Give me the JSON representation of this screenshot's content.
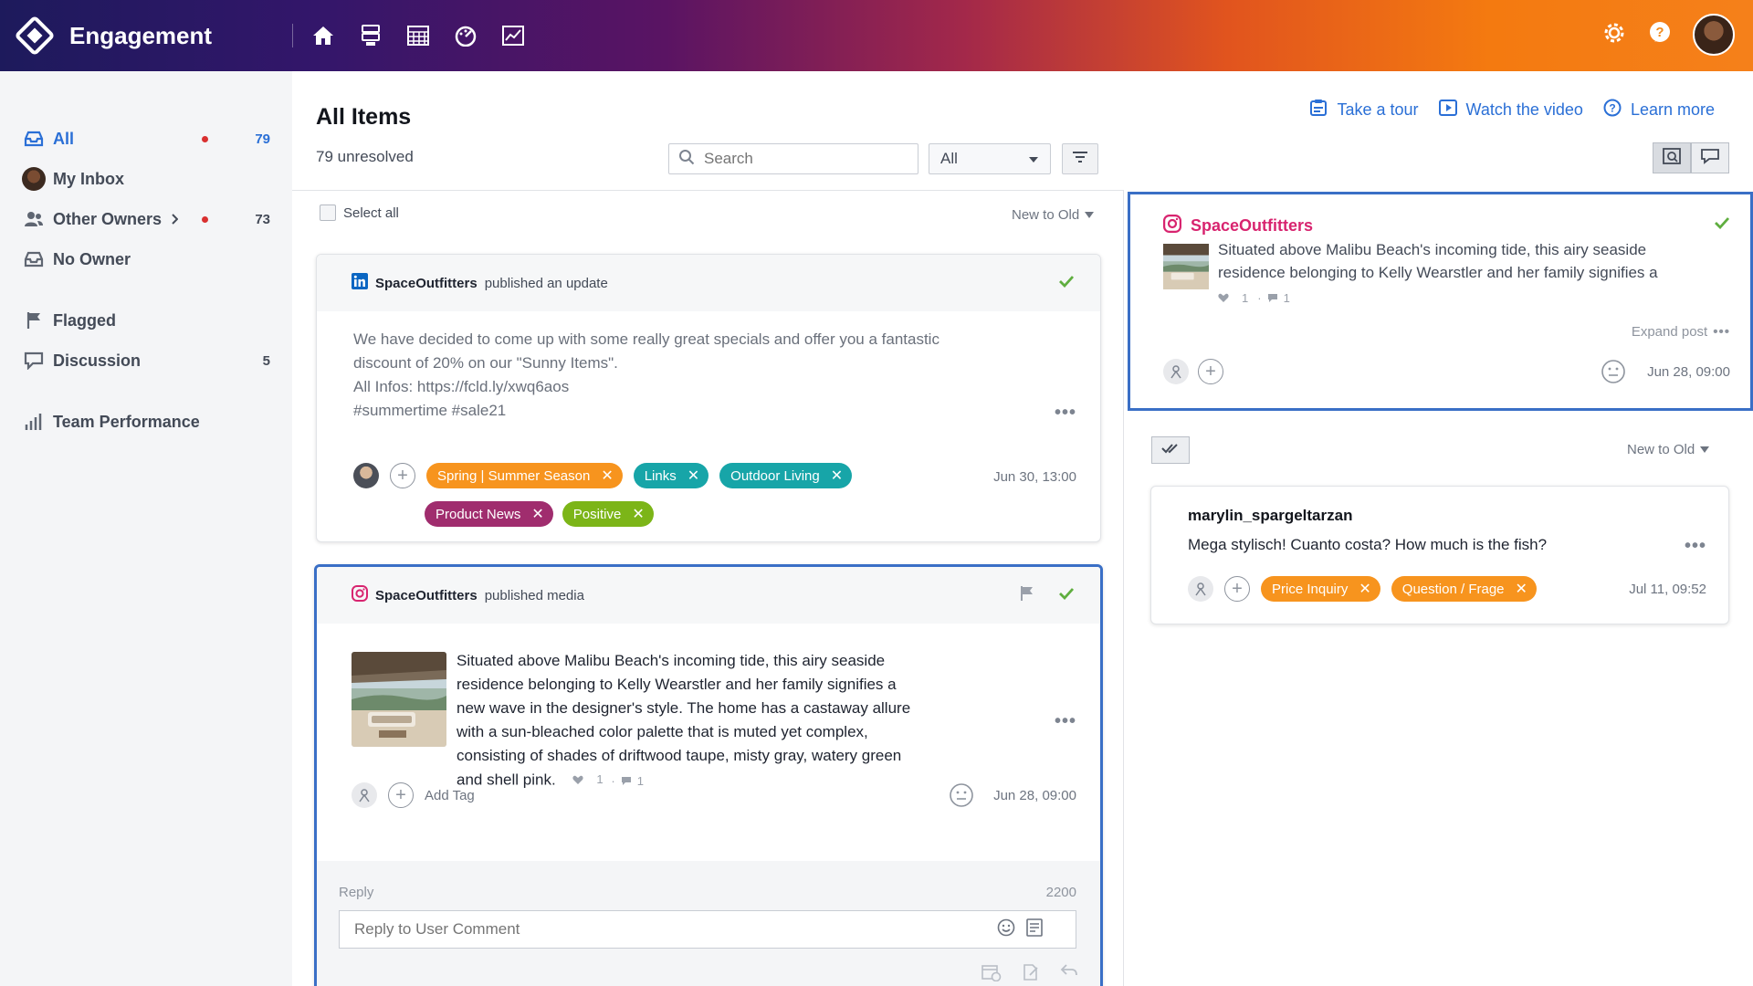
{
  "app": {
    "title": "Engagement"
  },
  "sidebar": {
    "items": [
      {
        "label": "All",
        "count": "79",
        "dot": true
      },
      {
        "label": "My Inbox",
        "count": ""
      },
      {
        "label": "Other Owners",
        "count": "73",
        "dot": true
      },
      {
        "label": "No Owner",
        "count": ""
      },
      {
        "label": "Flagged",
        "count": ""
      },
      {
        "label": "Discussion",
        "count": "5"
      },
      {
        "label": "Team Performance",
        "count": ""
      }
    ]
  },
  "header": {
    "title": "All Items",
    "subtitle": "79 unresolved",
    "search_placeholder": "Search",
    "filter_value": "All",
    "links": {
      "tour": "Take a tour",
      "video": "Watch the video",
      "learn": "Learn more"
    }
  },
  "list": {
    "select_all": "Select all",
    "sort": "New to Old",
    "cards": [
      {
        "account": "SpaceOutfitters",
        "action": "published an update",
        "network": "linkedin",
        "lines": [
          "We have decided to come up with some really great specials and offer you a fantastic",
          "discount of 20% on our \"Sunny Items\".",
          "All Infos: https://fcld.ly/xwq6aos",
          "#summertime #sale21"
        ],
        "tags": [
          {
            "label": "Spring | Summer Season",
            "color": "#f7941e"
          },
          {
            "label": "Links",
            "color": "#17a5a8"
          },
          {
            "label": "Outdoor Living",
            "color": "#17a5a8"
          },
          {
            "label": "Product News",
            "color": "#a02d6e"
          },
          {
            "label": "Positive",
            "color": "#7cb518"
          }
        ],
        "date": "Jun 30, 13:00"
      },
      {
        "account": "SpaceOutfitters",
        "action": "published media",
        "network": "instagram",
        "text": "Situated above Malibu Beach's incoming tide, this airy seaside residence belonging to Kelly Wearstler and her family signifies a new wave in the designer's style. The home has a castaway allure with a sun-bleached color palette that is muted yet complex, consisting of shades of driftwood taupe, misty gray, watery green and shell pink.",
        "likes": "1",
        "comments": "1",
        "add_tag": "Add Tag",
        "date": "Jun 28, 09:00",
        "reply_label": "Reply",
        "reply_count": "2200",
        "reply_placeholder": "Reply to User Comment"
      }
    ]
  },
  "detail": {
    "post": {
      "account": "SpaceOutfitters",
      "text": "Situated above Malibu Beach's incoming tide, this airy seaside residence belonging to Kelly Wearstler and her family signifies a",
      "likes": "1",
      "comments": "1",
      "expand": "Expand post",
      "date": "Jun 28, 09:00"
    },
    "sort": "New to Old",
    "comment": {
      "author": "marylin_spargeltarzan",
      "text": "Mega stylisch! Cuanto costa? How much is the fish?",
      "tags": [
        {
          "label": "Price Inquiry",
          "color": "#f7941e"
        },
        {
          "label": "Question / Frage",
          "color": "#f7941e"
        }
      ],
      "date": "Jul 11, 09:52"
    }
  },
  "colors": {
    "accent": "#2a6fd6",
    "instagram": "#d8246f",
    "linkedin": "#0a66c2",
    "resolved": "#5fae3f"
  }
}
